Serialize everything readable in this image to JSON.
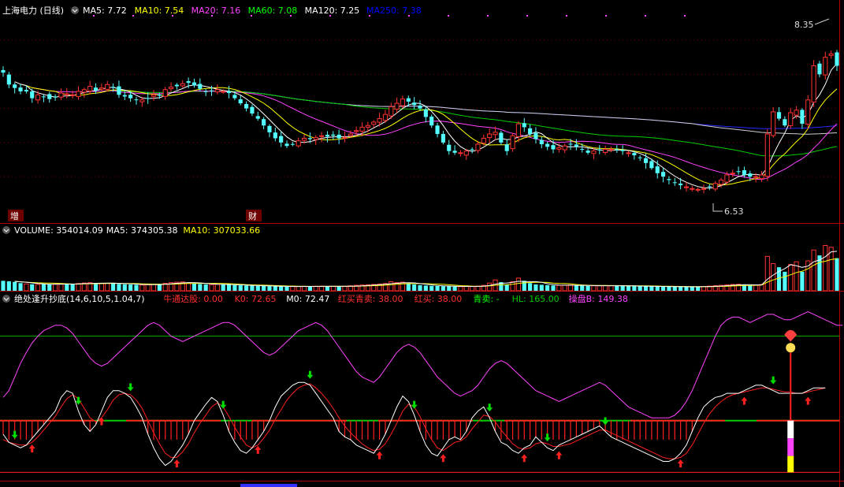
{
  "header": {
    "title": "上海电力 (日线)",
    "items": [
      {
        "text": "MA5: 7.72",
        "color": "#ffffff"
      },
      {
        "text": "MA10: 7.54",
        "color": "#ffff00"
      },
      {
        "text": "MA20: 7.16",
        "color": "#ff44ff"
      },
      {
        "text": "MA60: 7.08",
        "color": "#00ff00"
      },
      {
        "text": "MA120: 7.25",
        "color": "#ffffff"
      },
      {
        "text": "MA250: 7.38",
        "color": "#0000ff"
      }
    ]
  },
  "price_panel": {
    "high_label": "8.35",
    "low_label": "6.53",
    "tag_zeng": "增",
    "tag_cai": "财"
  },
  "volume_header": {
    "items": [
      {
        "text": "VOLUME: 354014.09",
        "color": "#ffffff"
      },
      {
        "text": "MA5: 374305.38",
        "color": "#ffffff"
      },
      {
        "text": "MA10: 307033.66",
        "color": "#ffff00"
      }
    ]
  },
  "indicator_header": {
    "items": [
      {
        "text": "绝处逢升抄底(14,6,10,5,1.04,7)",
        "color": "#ffffff"
      },
      {
        "text": "牛通达股: 0.00",
        "color": "#ff3030"
      },
      {
        "text": "K0: 72.65",
        "color": "#ff3030"
      },
      {
        "text": "M0: 72.47",
        "color": "#ffffff"
      },
      {
        "text": "红买青卖: 38.00",
        "color": "#ff3030"
      },
      {
        "text": "红买: 38.00",
        "color": "#ff3030"
      },
      {
        "text": "青卖: -",
        "color": "#00ff00"
      },
      {
        "text": "HL: 165.00",
        "color": "#00cc00"
      },
      {
        "text": "操盘B: 149.38",
        "color": "#ff44ff"
      }
    ]
  },
  "chart_data": [
    {
      "type": "candlestick",
      "ylim": [
        6.35,
        8.55
      ],
      "gridlines": [
        8.3,
        7.9,
        7.5,
        7.1,
        6.7
      ],
      "up_color": "#ff3232",
      "down_color": "#54ffff",
      "close": [
        7.92,
        7.78,
        7.74,
        7.7,
        7.7,
        7.62,
        7.66,
        7.64,
        7.61,
        7.63,
        7.68,
        7.67,
        7.66,
        7.7,
        7.72,
        7.76,
        7.71,
        7.74,
        7.78,
        7.75,
        7.66,
        7.64,
        7.62,
        7.6,
        7.6,
        7.62,
        7.66,
        7.65,
        7.72,
        7.75,
        7.76,
        7.79,
        7.8,
        7.77,
        7.73,
        7.7,
        7.71,
        7.72,
        7.7,
        7.68,
        7.62,
        7.56,
        7.5,
        7.44,
        7.38,
        7.3,
        7.22,
        7.15,
        7.1,
        7.06,
        7.08,
        7.12,
        7.15,
        7.14,
        7.16,
        7.18,
        7.17,
        7.18,
        7.15,
        7.16,
        7.2,
        7.24,
        7.28,
        7.3,
        7.34,
        7.38,
        7.43,
        7.52,
        7.56,
        7.61,
        7.58,
        7.54,
        7.5,
        7.4,
        7.3,
        7.2,
        7.1,
        7.0,
        6.98,
        6.98,
        7.0,
        7.02,
        7.08,
        7.15,
        7.2,
        7.22,
        7.1,
        7.0,
        7.18,
        7.32,
        7.28,
        7.2,
        7.14,
        7.08,
        7.05,
        7.02,
        7.04,
        7.06,
        7.08,
        7.05,
        7.02,
        6.98,
        7.0,
        7.01,
        7.02,
        7.02,
        7.01,
        7.0,
        6.98,
        6.95,
        6.92,
        6.86,
        6.8,
        6.74,
        6.7,
        6.66,
        6.63,
        6.6,
        6.58,
        6.56,
        6.55,
        6.56,
        6.58,
        6.62,
        6.66,
        6.72,
        6.74,
        6.76,
        6.72,
        6.7,
        6.7,
        6.72,
        7.2,
        7.46,
        7.38,
        7.3,
        7.45,
        7.48,
        7.32,
        7.6,
        8.0,
        7.9,
        8.1,
        8.14,
        8.0
      ]
    },
    {
      "type": "bar",
      "name": "VOLUME",
      "ylim": [
        0,
        600000
      ],
      "values": [
        110000,
        105000,
        98000,
        85000,
        76000,
        72000,
        70000,
        74000,
        71000,
        72000,
        78000,
        76000,
        74000,
        80000,
        86000,
        90000,
        84000,
        79000,
        82000,
        88000,
        75000,
        71000,
        69000,
        66000,
        65000,
        70000,
        73000,
        71000,
        82000,
        90000,
        95000,
        98000,
        88000,
        80000,
        74000,
        70000,
        68000,
        70000,
        72000,
        66000,
        62000,
        60000,
        58000,
        56000,
        54000,
        52000,
        50000,
        48000,
        47000,
        46000,
        47000,
        48000,
        49000,
        47000,
        50000,
        51000,
        49000,
        50000,
        48000,
        49000,
        55000,
        60000,
        64000,
        66000,
        70000,
        75000,
        80000,
        100000,
        90000,
        95000,
        80000,
        70000,
        62000,
        58000,
        54000,
        52000,
        50000,
        48000,
        47000,
        46000,
        48000,
        50000,
        52000,
        60000,
        85000,
        120000,
        95000,
        70000,
        100000,
        140000,
        110000,
        85000,
        70000,
        66000,
        62000,
        58000,
        60000,
        62000,
        64000,
        58000,
        56000,
        54000,
        55000,
        56000,
        57000,
        56000,
        55000,
        54000,
        52000,
        51000,
        50000,
        49000,
        48000,
        47000,
        46000,
        45000,
        44000,
        43000,
        44000,
        45000,
        46000,
        48000,
        52000,
        56000,
        60000,
        66000,
        70000,
        72000,
        65000,
        60000,
        60000,
        70000,
        380000,
        300000,
        260000,
        210000,
        290000,
        320000,
        210000,
        330000,
        450000,
        390000,
        500000,
        480000,
        360000
      ],
      "ma5": [],
      "ma10": []
    },
    {
      "type": "line",
      "name": "indicator",
      "ylim": [
        -5,
        120
      ],
      "ref_levels": [
        0,
        25,
        38,
        100
      ],
      "k": [
        28,
        22,
        20,
        18,
        20,
        25,
        30,
        35,
        40,
        45,
        55,
        60,
        58,
        45,
        35,
        30,
        35,
        45,
        55,
        60,
        60,
        58,
        55,
        48,
        40,
        28,
        18,
        10,
        5,
        8,
        14,
        20,
        28,
        38,
        44,
        50,
        55,
        52,
        42,
        30,
        22,
        16,
        14,
        18,
        24,
        30,
        38,
        48,
        56,
        60,
        64,
        66,
        66,
        64,
        58,
        52,
        46,
        40,
        30,
        26,
        24,
        20,
        18,
        16,
        14,
        20,
        28,
        38,
        48,
        56,
        52,
        42,
        30,
        20,
        14,
        12,
        18,
        24,
        26,
        24,
        30,
        40,
        45,
        48,
        40,
        30,
        22,
        20,
        16,
        14,
        18,
        20,
        26,
        22,
        18,
        16,
        20,
        22,
        24,
        26,
        28,
        30,
        32,
        34,
        30,
        26,
        24,
        22,
        20,
        18,
        16,
        14,
        12,
        10,
        8,
        8,
        10,
        14,
        20,
        30,
        40,
        48,
        52,
        55,
        56,
        58,
        58,
        58,
        60,
        62,
        64,
        64,
        62,
        60,
        58,
        58,
        58,
        58,
        58,
        60,
        62,
        62,
        62
      ],
      "m": [
        24,
        22,
        21,
        20,
        20,
        22,
        26,
        31,
        36,
        41,
        48,
        54,
        57,
        54,
        47,
        40,
        37,
        40,
        46,
        53,
        57,
        58,
        57,
        53,
        47,
        38,
        29,
        21,
        14,
        11,
        11,
        15,
        21,
        29,
        36,
        42,
        48,
        51,
        48,
        41,
        33,
        26,
        20,
        18,
        20,
        25,
        31,
        39,
        46,
        53,
        58,
        62,
        64,
        65,
        62,
        58,
        53,
        47,
        40,
        34,
        29,
        25,
        21,
        18,
        16,
        17,
        21,
        28,
        36,
        45,
        50,
        48,
        41,
        32,
        24,
        18,
        16,
        19,
        22,
        23,
        26,
        32,
        37,
        42,
        41,
        37,
        31,
        26,
        21,
        18,
        17,
        18,
        21,
        22,
        21,
        19,
        19,
        20,
        21,
        23,
        25,
        27,
        29,
        31,
        31,
        29,
        27,
        25,
        23,
        21,
        19,
        17,
        15,
        13,
        11,
        10,
        10,
        11,
        14,
        20,
        28,
        36,
        43,
        48,
        52,
        55,
        57,
        58,
        59,
        60,
        61,
        62,
        62,
        61,
        60,
        59,
        59,
        58,
        58,
        59,
        60,
        61,
        62
      ],
      "hl": [
        55,
        60,
        70,
        80,
        88,
        95,
        100,
        104,
        106,
        108,
        108,
        106,
        102,
        96,
        90,
        84,
        80,
        78,
        80,
        84,
        88,
        92,
        96,
        100,
        104,
        108,
        110,
        108,
        104,
        100,
        98,
        96,
        98,
        100,
        102,
        104,
        106,
        108,
        110,
        110,
        108,
        104,
        100,
        96,
        92,
        88,
        86,
        88,
        92,
        96,
        100,
        104,
        106,
        108,
        110,
        108,
        104,
        98,
        92,
        86,
        80,
        74,
        70,
        68,
        66,
        70,
        76,
        82,
        88,
        92,
        94,
        92,
        88,
        82,
        76,
        70,
        66,
        62,
        58,
        56,
        58,
        60,
        64,
        70,
        76,
        80,
        82,
        80,
        76,
        72,
        68,
        64,
        60,
        58,
        56,
        54,
        52,
        54,
        56,
        58,
        60,
        62,
        64,
        66,
        64,
        60,
        56,
        52,
        48,
        46,
        44,
        42,
        40,
        40,
        40,
        40,
        42,
        46,
        52,
        60,
        70,
        80,
        90,
        100,
        108,
        112,
        114,
        114,
        112,
        110,
        112,
        114,
        116,
        116,
        114,
        112,
        112,
        114,
        116,
        118,
        116,
        114,
        112,
        110,
        108,
        108
      ]
    }
  ]
}
